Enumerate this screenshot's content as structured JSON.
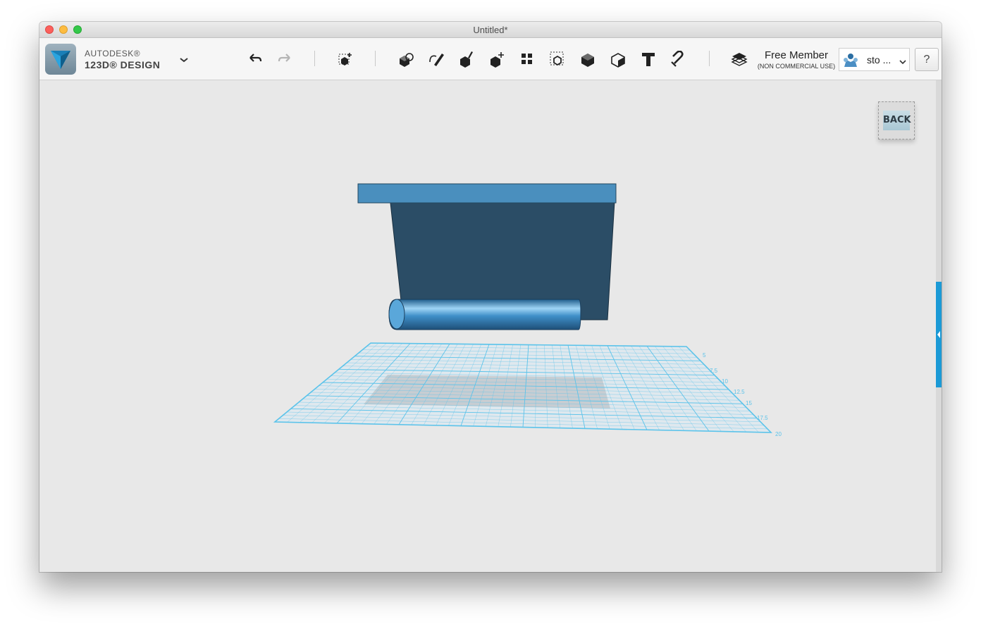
{
  "window": {
    "title": "Untitled*"
  },
  "app": {
    "brand_line1": "AUTODESK®",
    "brand_line2": "123D® DESIGN"
  },
  "toolbar": {
    "tools": [
      {
        "name": "undo-button",
        "icon": "undo-icon"
      },
      {
        "name": "redo-button",
        "icon": "redo-icon"
      },
      {
        "name": "transform-button",
        "icon": "transform-icon"
      },
      {
        "name": "primitives-button",
        "icon": "primitives-icon"
      },
      {
        "name": "sketch-button",
        "icon": "sketch-icon"
      },
      {
        "name": "construct-button",
        "icon": "construct-icon"
      },
      {
        "name": "modify-button",
        "icon": "modify-icon"
      },
      {
        "name": "pattern-button",
        "icon": "pattern-icon"
      },
      {
        "name": "group-button",
        "icon": "group-icon"
      },
      {
        "name": "combine-button",
        "icon": "combine-icon"
      },
      {
        "name": "measure-button",
        "icon": "measure-icon"
      },
      {
        "name": "text-button",
        "icon": "text-icon"
      },
      {
        "name": "snap-button",
        "icon": "snap-icon"
      },
      {
        "name": "materials-button",
        "icon": "layers-icon"
      }
    ]
  },
  "account": {
    "membership": "Free Member",
    "membership_note": "(NON COMMERCIAL USE)",
    "user_name": "sto ...",
    "help": "?"
  },
  "viewcube": {
    "face_label": "BACK"
  },
  "grid": {
    "axis_labels": [
      "5",
      "7.5",
      "10",
      "12.5",
      "15",
      "17.5",
      "20"
    ]
  },
  "colors": {
    "accent": "#1b9ad6",
    "box_top": "#4a8fbe",
    "box_body": "#2b4d66",
    "cylinder": "#3f8fc8",
    "grid": "#5bc3ea"
  }
}
